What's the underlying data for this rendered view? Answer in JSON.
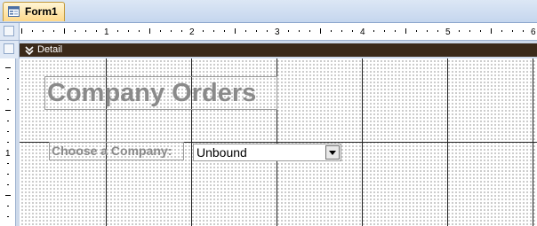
{
  "window": {
    "tab_label": "Form1",
    "tab_icon": "form-icon"
  },
  "ruler": {
    "horizontal_numbers": [
      "1",
      "2",
      "3",
      "4",
      "5",
      "6"
    ],
    "vertical_numbers": [
      "1"
    ]
  },
  "section": {
    "label": "Detail",
    "icon": "section-arrow-icon"
  },
  "form": {
    "title_label": "Company Orders",
    "choose_label": "Choose a Company:",
    "combo_value": "Unbound",
    "combo_button_icon": "dropdown-arrow-icon"
  },
  "colors": {
    "section_bar": "#3b2a1a",
    "tab_active": "#ffd98a",
    "label_text": "#8a8a8a"
  }
}
